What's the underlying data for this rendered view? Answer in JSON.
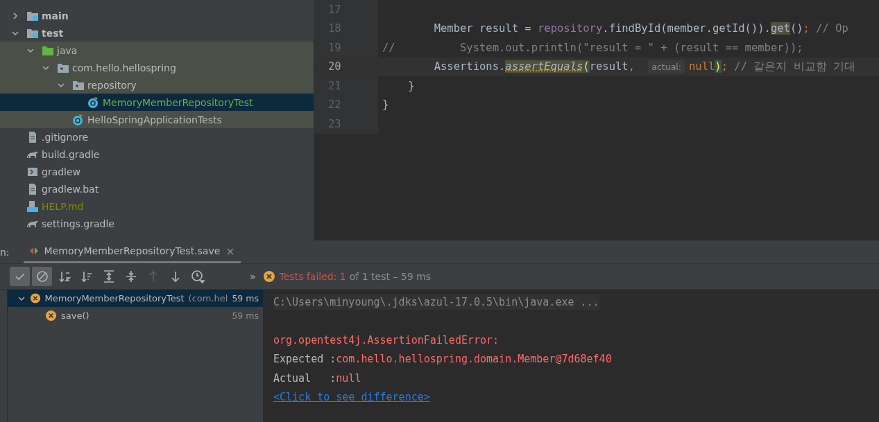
{
  "project_tree": [
    {
      "label": "main",
      "kind": "source-root",
      "expanded": false,
      "highlighted": false,
      "selected": false,
      "color": "#bbbbbb"
    },
    {
      "label": "test",
      "kind": "source-root",
      "expanded": true,
      "highlighted": false,
      "selected": false,
      "color": "#bbbbbb",
      "children": [
        {
          "label": "java",
          "kind": "test-folder",
          "expanded": true,
          "highlighted": true,
          "selected": false,
          "color": "#bbbbbb",
          "children": [
            {
              "label": "com.hello.hellospring",
              "kind": "package",
              "expanded": true,
              "highlighted": true,
              "selected": false,
              "color": "#bbbbbb",
              "children": [
                {
                  "label": "repository",
                  "kind": "package",
                  "expanded": true,
                  "highlighted": true,
                  "selected": false,
                  "color": "#bbbbbb",
                  "children": [
                    {
                      "label": "MemoryMemberRepositoryTest",
                      "kind": "class",
                      "selected": true,
                      "color": "#62b543"
                    }
                  ]
                },
                {
                  "label": "HelloSpringApplicationTests",
                  "kind": "class",
                  "highlighted": true,
                  "selected": false,
                  "color": "#bbbbbb"
                }
              ]
            }
          ]
        }
      ]
    },
    {
      "label": ".gitignore",
      "kind": "ignore-file",
      "highlighted": false,
      "selected": false,
      "color": "#bbbbbb"
    },
    {
      "label": "build.gradle",
      "kind": "gradle",
      "highlighted": false,
      "selected": false,
      "color": "#bbbbbb"
    },
    {
      "label": "gradlew",
      "kind": "shell",
      "highlighted": false,
      "selected": false,
      "color": "#bbbbbb"
    },
    {
      "label": "gradlew.bat",
      "kind": "text-file",
      "highlighted": false,
      "selected": false,
      "color": "#bbbbbb"
    },
    {
      "label": "HELP.md",
      "kind": "markdown",
      "highlighted": false,
      "selected": false,
      "color": "#848504"
    },
    {
      "label": "settings.gradle",
      "kind": "gradle",
      "highlighted": false,
      "selected": false,
      "color": "#bbbbbb"
    }
  ],
  "editor": {
    "lines": [
      {
        "number": "17",
        "current": false
      },
      {
        "number": "18",
        "current": false,
        "tokens": [
          {
            "text": "        Member result = ",
            "kind": "text"
          },
          {
            "text": "repository",
            "kind": "field"
          },
          {
            "text": ".findById(member.getId()).",
            "kind": "text"
          },
          {
            "text": "get",
            "kind": "usage"
          },
          {
            "text": "()",
            "kind": "text"
          },
          {
            "text": ";",
            "kind": "keyword"
          },
          {
            "text": " // Op",
            "kind": "comment"
          }
        ]
      },
      {
        "number": "19",
        "current": false,
        "tokens": [
          {
            "text": "//          System.out.println(\"result = \" + (result == member));",
            "kind": "comment"
          }
        ]
      },
      {
        "number": "20",
        "current": true,
        "tokens": [
          {
            "text": "        Assertions.",
            "kind": "text"
          },
          {
            "text": "assertEquals",
            "kind": "static-call"
          },
          {
            "text": "(",
            "kind": "brace"
          },
          {
            "text": "result",
            "kind": "text"
          },
          {
            "text": ", ",
            "kind": "keyword"
          },
          {
            "text": "actual:",
            "kind": "hint"
          },
          {
            "text": "null",
            "kind": "keyword"
          },
          {
            "text": ")",
            "kind": "brace"
          },
          {
            "text": ";",
            "kind": "keyword"
          },
          {
            "text": " // 같은지 비교함 기대",
            "kind": "comment"
          }
        ]
      },
      {
        "number": "21",
        "current": false,
        "tokens": [
          {
            "text": "    }",
            "kind": "text"
          }
        ]
      },
      {
        "number": "22",
        "current": false,
        "tokens": [
          {
            "text": "}",
            "kind": "text"
          }
        ]
      },
      {
        "number": "23",
        "current": false
      }
    ]
  },
  "run_panel": {
    "label": "n:",
    "tab": {
      "title": "MemoryMemberRepositoryTest.save",
      "close": "×"
    },
    "toolbar": [
      {
        "kind": "check",
        "on": true,
        "disabled": false
      },
      {
        "kind": "stop-circle",
        "on": true,
        "disabled": false
      },
      {
        "kind": "sort-alpha",
        "on": false,
        "disabled": false
      },
      {
        "kind": "sort-duration",
        "on": false,
        "disabled": false
      },
      {
        "kind": "expand-all",
        "on": false,
        "disabled": false
      },
      {
        "kind": "collapse-all",
        "on": false,
        "disabled": false
      },
      {
        "kind": "arrow-up",
        "on": false,
        "disabled": true
      },
      {
        "kind": "arrow-down",
        "on": false,
        "disabled": false
      },
      {
        "kind": "history",
        "on": false,
        "disabled": false
      }
    ],
    "more": "»",
    "status": {
      "failed": "Tests failed: 1",
      "rest": "of 1 test – 59 ms"
    },
    "tests": [
      {
        "name": "MemoryMemberRepositoryTest",
        "detail": "(com.hel",
        "time": "59 ms",
        "selected": true,
        "expanded": true,
        "children": [
          {
            "name": "save()",
            "time": "59 ms",
            "selected": false
          }
        ]
      }
    ],
    "console": [
      {
        "kind": "command",
        "text": "C:\\Users\\minyoung\\.jdks\\azul-17.0.5\\bin\\java.exe ..."
      },
      {
        "kind": "blank"
      },
      {
        "kind": "error",
        "text": "org.opentest4j.AssertionFailedError:"
      },
      {
        "kind": "pair",
        "label": "Expected :",
        "value": "com.hello.hellospring.domain.Member@7d68ef40"
      },
      {
        "kind": "pair",
        "label": "Actual   :",
        "value": "null"
      },
      {
        "kind": "link",
        "text": "<Click to see difference>"
      }
    ]
  }
}
